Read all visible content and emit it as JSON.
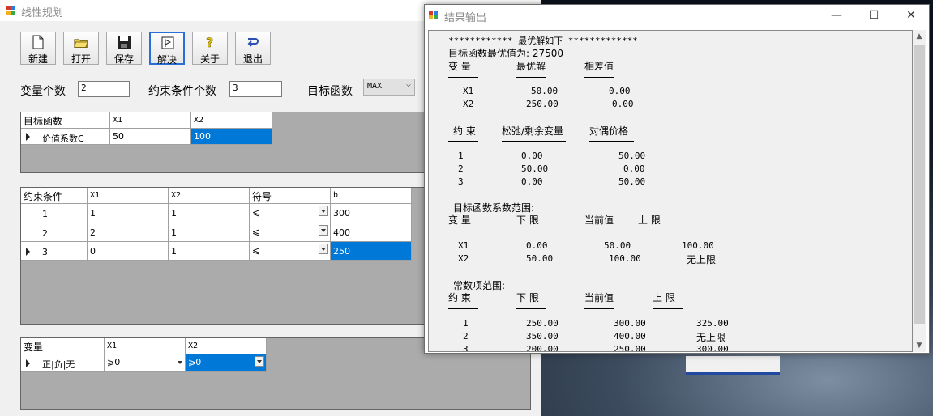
{
  "main_window": {
    "title": "线性规划",
    "toolbar": [
      {
        "label": "新建",
        "icon": "new-file-icon"
      },
      {
        "label": "打开",
        "icon": "open-folder-icon"
      },
      {
        "label": "保存",
        "icon": "save-disk-icon"
      },
      {
        "label": "解决",
        "icon": "solve-flag-icon"
      },
      {
        "label": "关于",
        "icon": "help-question-icon"
      },
      {
        "label": "退出",
        "icon": "exit-icon"
      }
    ],
    "var_count_label": "变量个数",
    "var_count_value": "2",
    "constraint_count_label": "约束条件个数",
    "constraint_count_value": "3",
    "objective_label": "目标函数",
    "objective_value": "MAX",
    "objective_grid": {
      "headers": [
        "目标函数",
        "X1",
        "X2"
      ],
      "row_label": "价值系数C",
      "values": [
        "50",
        "100"
      ]
    },
    "constraint_grid": {
      "headers": [
        "约束条件",
        "X1",
        "X2",
        "符号",
        "b"
      ],
      "rows": [
        {
          "index": "1",
          "x1": "1",
          "x2": "1",
          "sign": "⩽",
          "b": "300"
        },
        {
          "index": "2",
          "x1": "2",
          "x2": "1",
          "sign": "⩽",
          "b": "400"
        },
        {
          "index": "3",
          "x1": "0",
          "x2": "1",
          "sign": "⩽",
          "b": "250"
        }
      ]
    },
    "sign_grid": {
      "headers": [
        "变量",
        "X1",
        "X2"
      ],
      "row_label": "正|负|无",
      "values": [
        "⩾0",
        "⩾0"
      ]
    }
  },
  "result_window": {
    "title": "结果输出",
    "heading": "************ 最优解如下 *************",
    "objective_line": "目标函数最优值为: 27500",
    "sol_headers": [
      "变  量",
      "最优解",
      "相差值"
    ],
    "sol_rows": [
      [
        "X1",
        "50.00",
        "0.00"
      ],
      [
        "X2",
        "250.00",
        "0.00"
      ]
    ],
    "con_headers": [
      "约  束",
      "松弛/剩余变量",
      "对偶价格"
    ],
    "con_rows": [
      [
        "1",
        "0.00",
        "50.00"
      ],
      [
        "2",
        "50.00",
        "0.00"
      ],
      [
        "3",
        "0.00",
        "50.00"
      ]
    ],
    "obj_range_title": "目标函数系数范围:",
    "obj_range_headers": [
      "变  量",
      "下  限",
      "当前值",
      "上  限"
    ],
    "obj_range_rows": [
      [
        "X1",
        "0.00",
        "50.00",
        "100.00"
      ],
      [
        "X2",
        "50.00",
        "100.00",
        "无上限"
      ]
    ],
    "rhs_range_title": "常数项范围:",
    "rhs_range_headers": [
      "约  束",
      "下  限",
      "当前值",
      "上  限"
    ],
    "rhs_range_rows": [
      [
        "1",
        "250.00",
        "300.00",
        "325.00"
      ],
      [
        "2",
        "350.00",
        "400.00",
        "无上限"
      ],
      [
        "3",
        "200.00",
        "250.00",
        "300.00"
      ]
    ]
  }
}
